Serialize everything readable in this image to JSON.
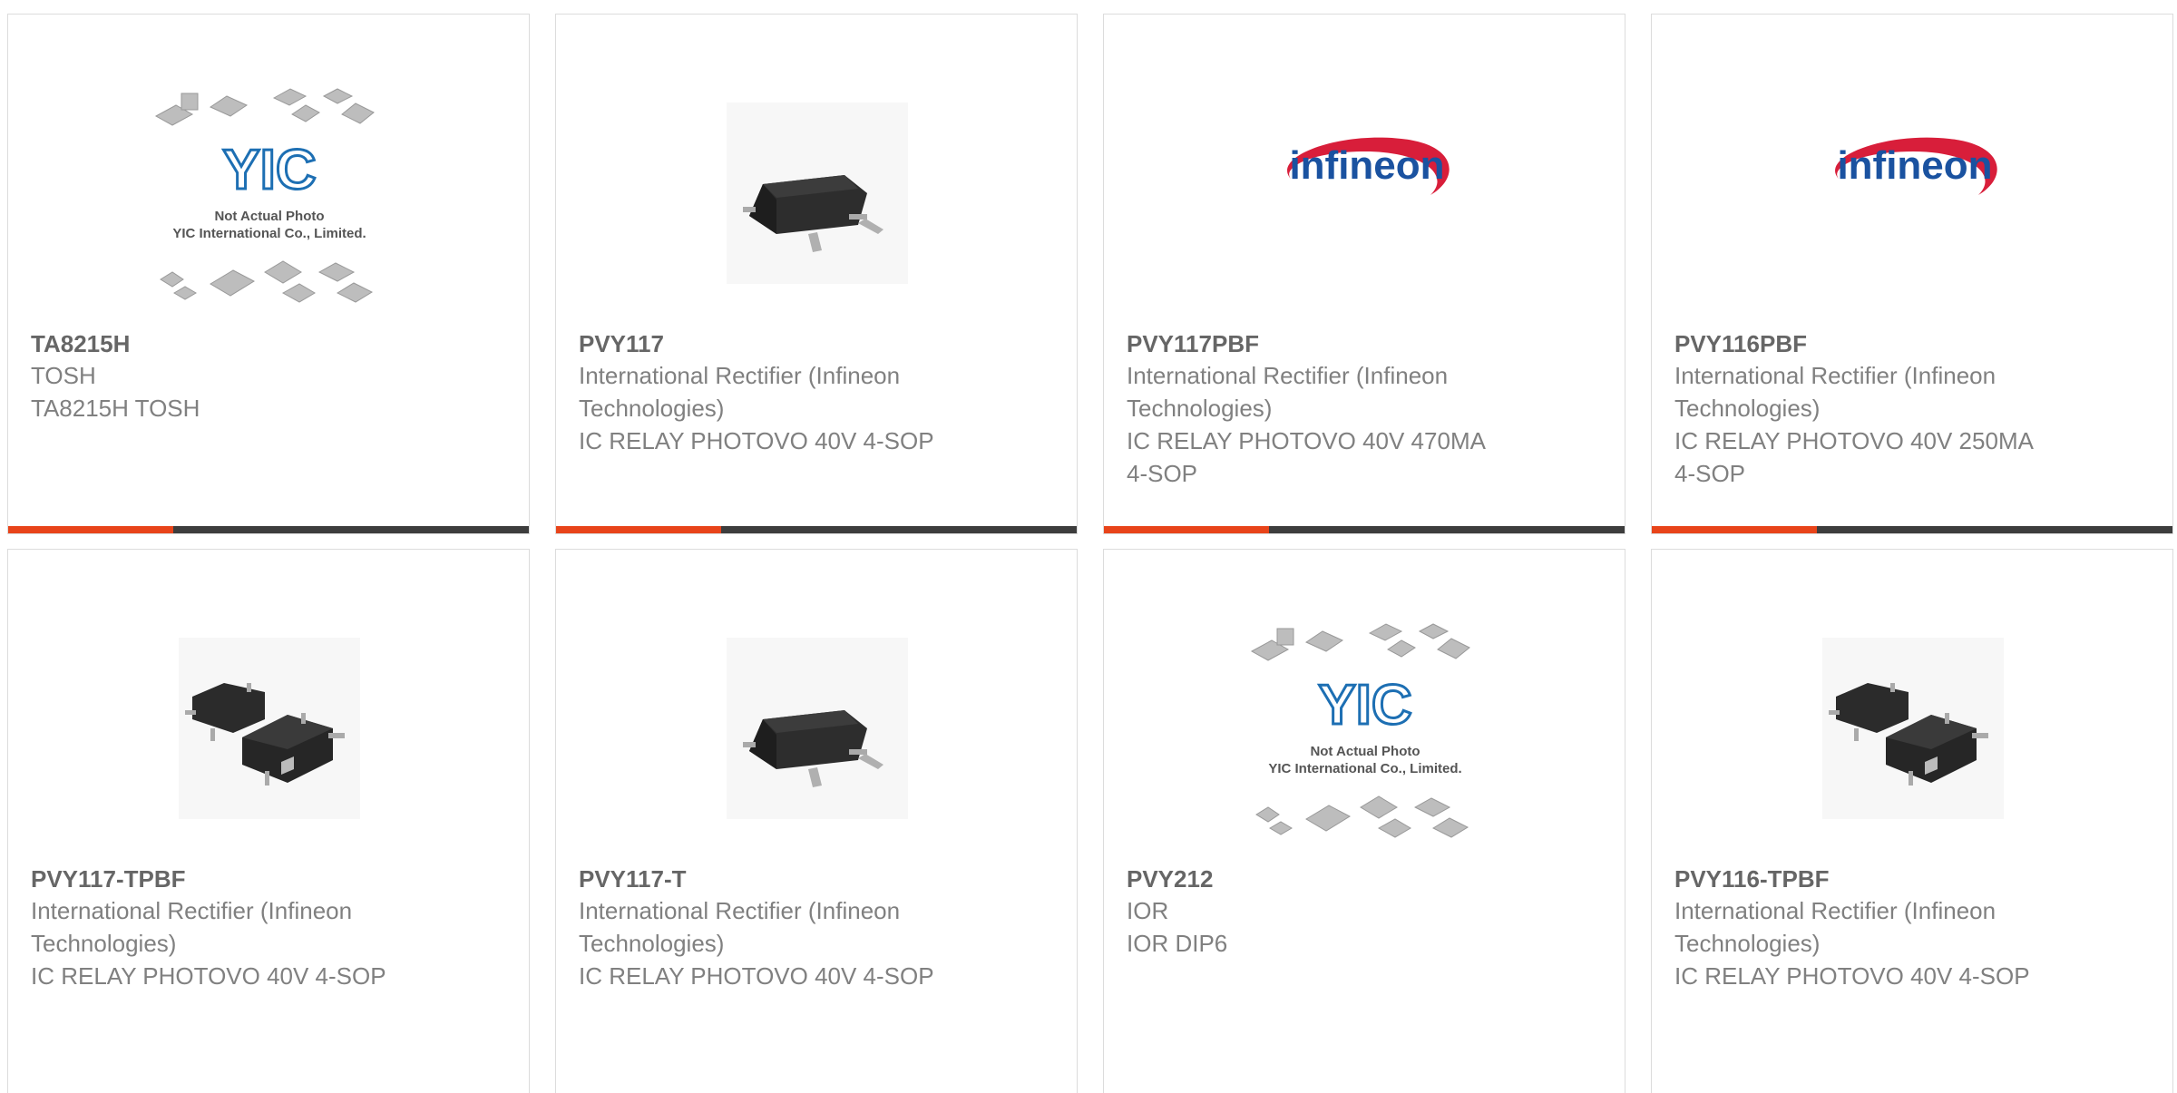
{
  "colors": {
    "accent": "#e8441a",
    "bar": "#3d3d3d",
    "infineon_red": "#d81e3a",
    "infineon_blue": "#1a52a0"
  },
  "products": [
    {
      "part": "TA8215H",
      "manufacturer": "TOSH",
      "description": "TA8215H TOSH",
      "image": "yic-placeholder"
    },
    {
      "part": "PVY117",
      "manufacturer": "International Rectifier (Infineon Technologies)",
      "description": "IC RELAY PHOTOVO 40V 4-SOP",
      "image": "sop-chip"
    },
    {
      "part": "PVY117PBF",
      "manufacturer": "International Rectifier (Infineon Technologies)",
      "description": "IC RELAY PHOTOVO 40V 470MA 4-SOP",
      "image": "infineon-logo"
    },
    {
      "part": "PVY116PBF",
      "manufacturer": "International Rectifier (Infineon Technologies)",
      "description": "IC RELAY PHOTOVO 40V 250MA 4-SOP",
      "image": "infineon-logo"
    },
    {
      "part": "PVY117-TPBF",
      "manufacturer": "International Rectifier (Infineon Technologies)",
      "description": "IC RELAY PHOTOVO 40V 4-SOP",
      "image": "two-sop-chips"
    },
    {
      "part": "PVY117-T",
      "manufacturer": "International Rectifier (Infineon Technologies)",
      "description": "IC RELAY PHOTOVO 40V 4-SOP",
      "image": "sop-chip"
    },
    {
      "part": "PVY212",
      "manufacturer": "IOR",
      "description": "IOR DIP6",
      "image": "yic-placeholder"
    },
    {
      "part": "PVY116-TPBF",
      "manufacturer": "International Rectifier (Infineon Technologies)",
      "description": "IC RELAY PHOTOVO 40V 4-SOP",
      "image": "two-sop-chips"
    }
  ],
  "placeholder": {
    "line1": "Not Actual Photo",
    "line2": "YIC International Co., Limited.",
    "logo": "YIC"
  },
  "infineon_logo_text": "infineon"
}
